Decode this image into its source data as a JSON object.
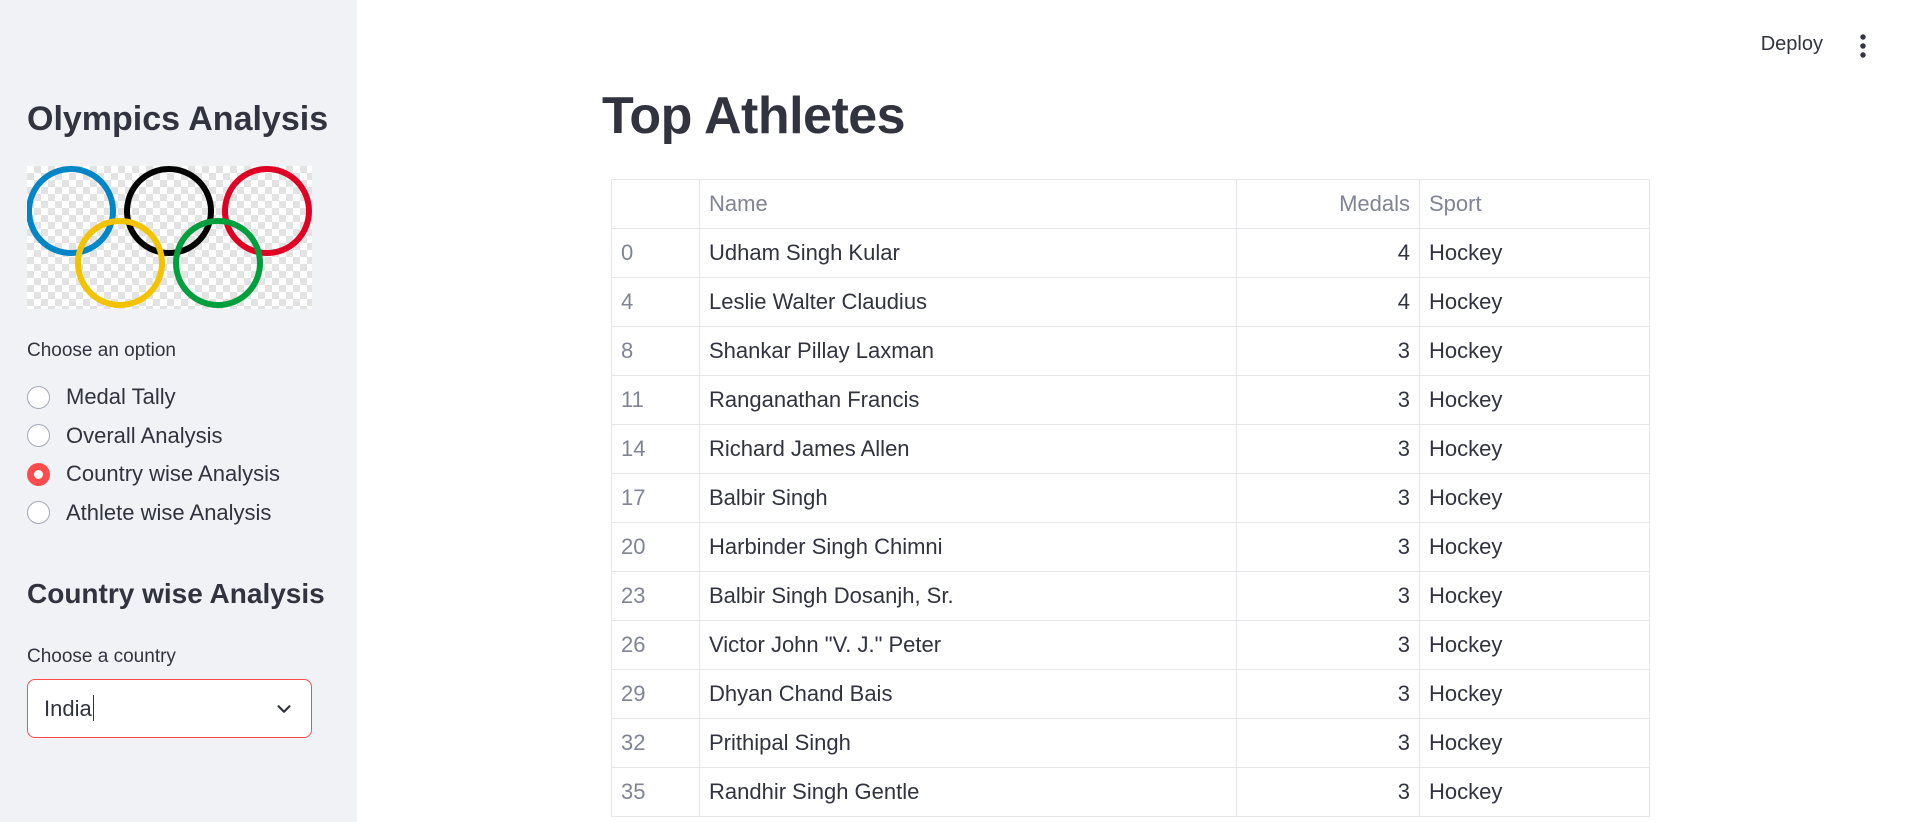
{
  "sidebar": {
    "title": "Olympics Analysis",
    "logo_icon": "olympic-rings-icon",
    "option_label": "Choose an option",
    "options": [
      {
        "label": "Medal Tally",
        "selected": false
      },
      {
        "label": "Overall Analysis",
        "selected": false
      },
      {
        "label": "Country wise Analysis",
        "selected": true
      },
      {
        "label": "Athlete wise Analysis",
        "selected": false
      }
    ],
    "subheader": "Country wise Analysis",
    "country_label": "Choose a country",
    "country_value": "India"
  },
  "topbar": {
    "deploy_label": "Deploy",
    "menu_icon": "kebab-menu-icon"
  },
  "main": {
    "title": "Top Athletes",
    "table": {
      "columns": [
        "",
        "Name",
        "Medals",
        "Sport"
      ],
      "rows": [
        [
          "0",
          "Udham Singh Kular",
          "4",
          "Hockey"
        ],
        [
          "4",
          "Leslie Walter Claudius",
          "4",
          "Hockey"
        ],
        [
          "8",
          "Shankar Pillay Laxman",
          "3",
          "Hockey"
        ],
        [
          "11",
          "Ranganathan Francis",
          "3",
          "Hockey"
        ],
        [
          "14",
          "Richard James Allen",
          "3",
          "Hockey"
        ],
        [
          "17",
          "Balbir Singh",
          "3",
          "Hockey"
        ],
        [
          "20",
          "Harbinder Singh Chimni",
          "3",
          "Hockey"
        ],
        [
          "23",
          "Balbir Singh Dosanjh, Sr.",
          "3",
          "Hockey"
        ],
        [
          "26",
          "Victor John \"V. J.\" Peter",
          "3",
          "Hockey"
        ],
        [
          "29",
          "Dhyan Chand Bais",
          "3",
          "Hockey"
        ],
        [
          "32",
          "Prithipal Singh",
          "3",
          "Hockey"
        ],
        [
          "35",
          "Randhir Singh Gentle",
          "3",
          "Hockey"
        ]
      ]
    }
  },
  "colors": {
    "accent": "#ff4b4b",
    "sidebar_bg": "#f0f2f6",
    "text": "#31333f",
    "muted": "#808495"
  }
}
